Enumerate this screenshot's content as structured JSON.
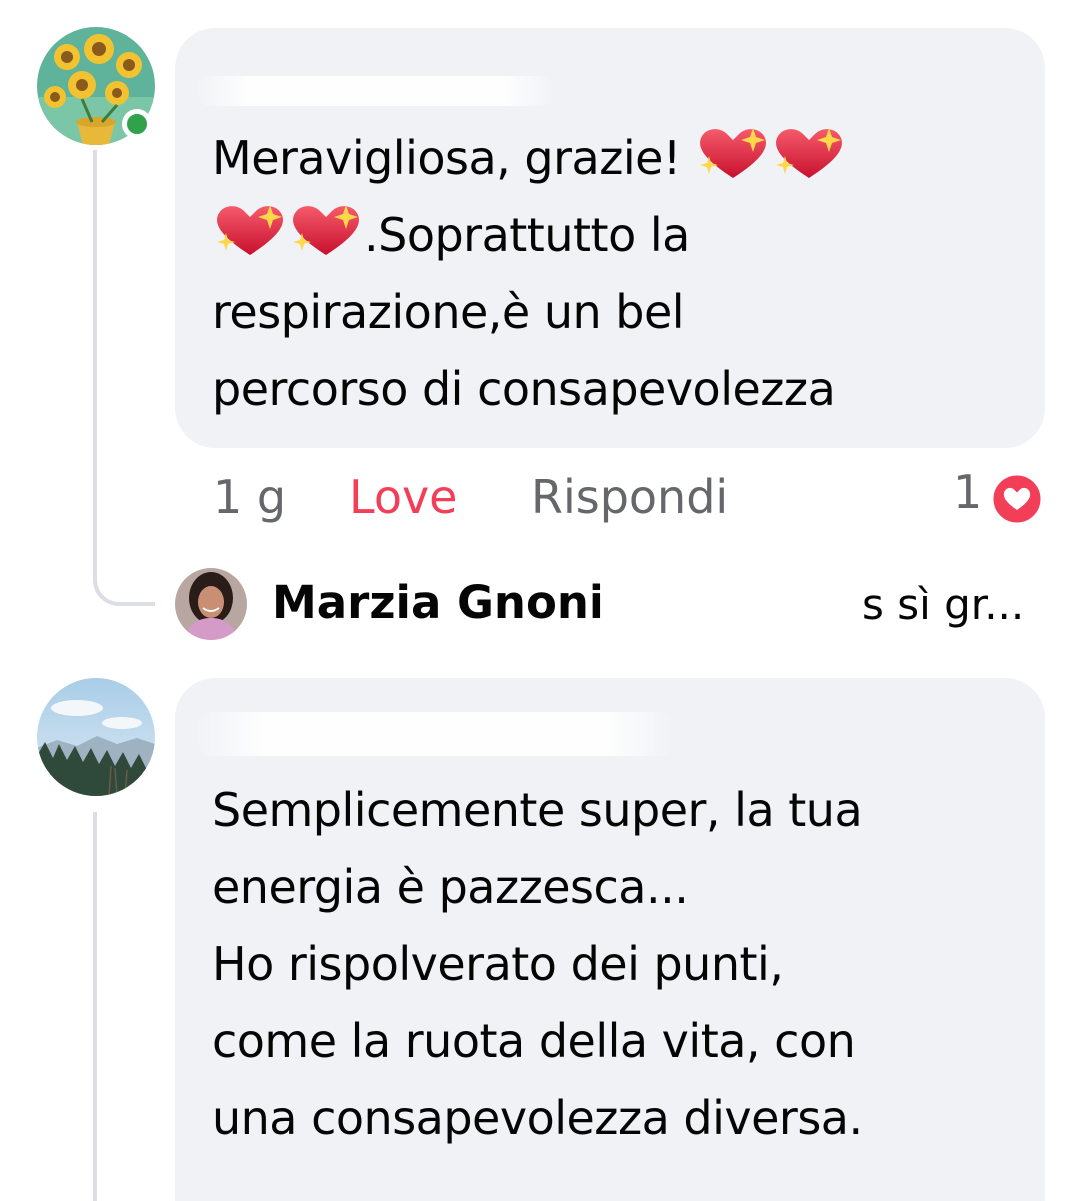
{
  "comment1": {
    "line1": "Meravigliosa, grazie!",
    "line2_suffix": ".Soprattutto la",
    "line3": "respirazione,è un bel",
    "line4": "percorso di consapevolezza",
    "emoji": "sparkling-heart"
  },
  "actions": {
    "time": "1 g",
    "love": "Love",
    "reply": "Rispondi",
    "reaction_count": "1",
    "reaction_icon": "love-reaction-icon"
  },
  "reply_preview": {
    "author": "Marzia Gnoni",
    "snippet": "s sì gr..."
  },
  "comment2": {
    "text": "Semplicemente super, la tua\nenergia è pazzesca...\nHo rispolverato dei punti,\ncome la ruota della vita, con\nuna consapevolezza diversa."
  },
  "colors": {
    "bubble": "#f0f2f5",
    "love": "#f33e58",
    "secondary_text": "#65676b",
    "online": "#31a24c"
  }
}
